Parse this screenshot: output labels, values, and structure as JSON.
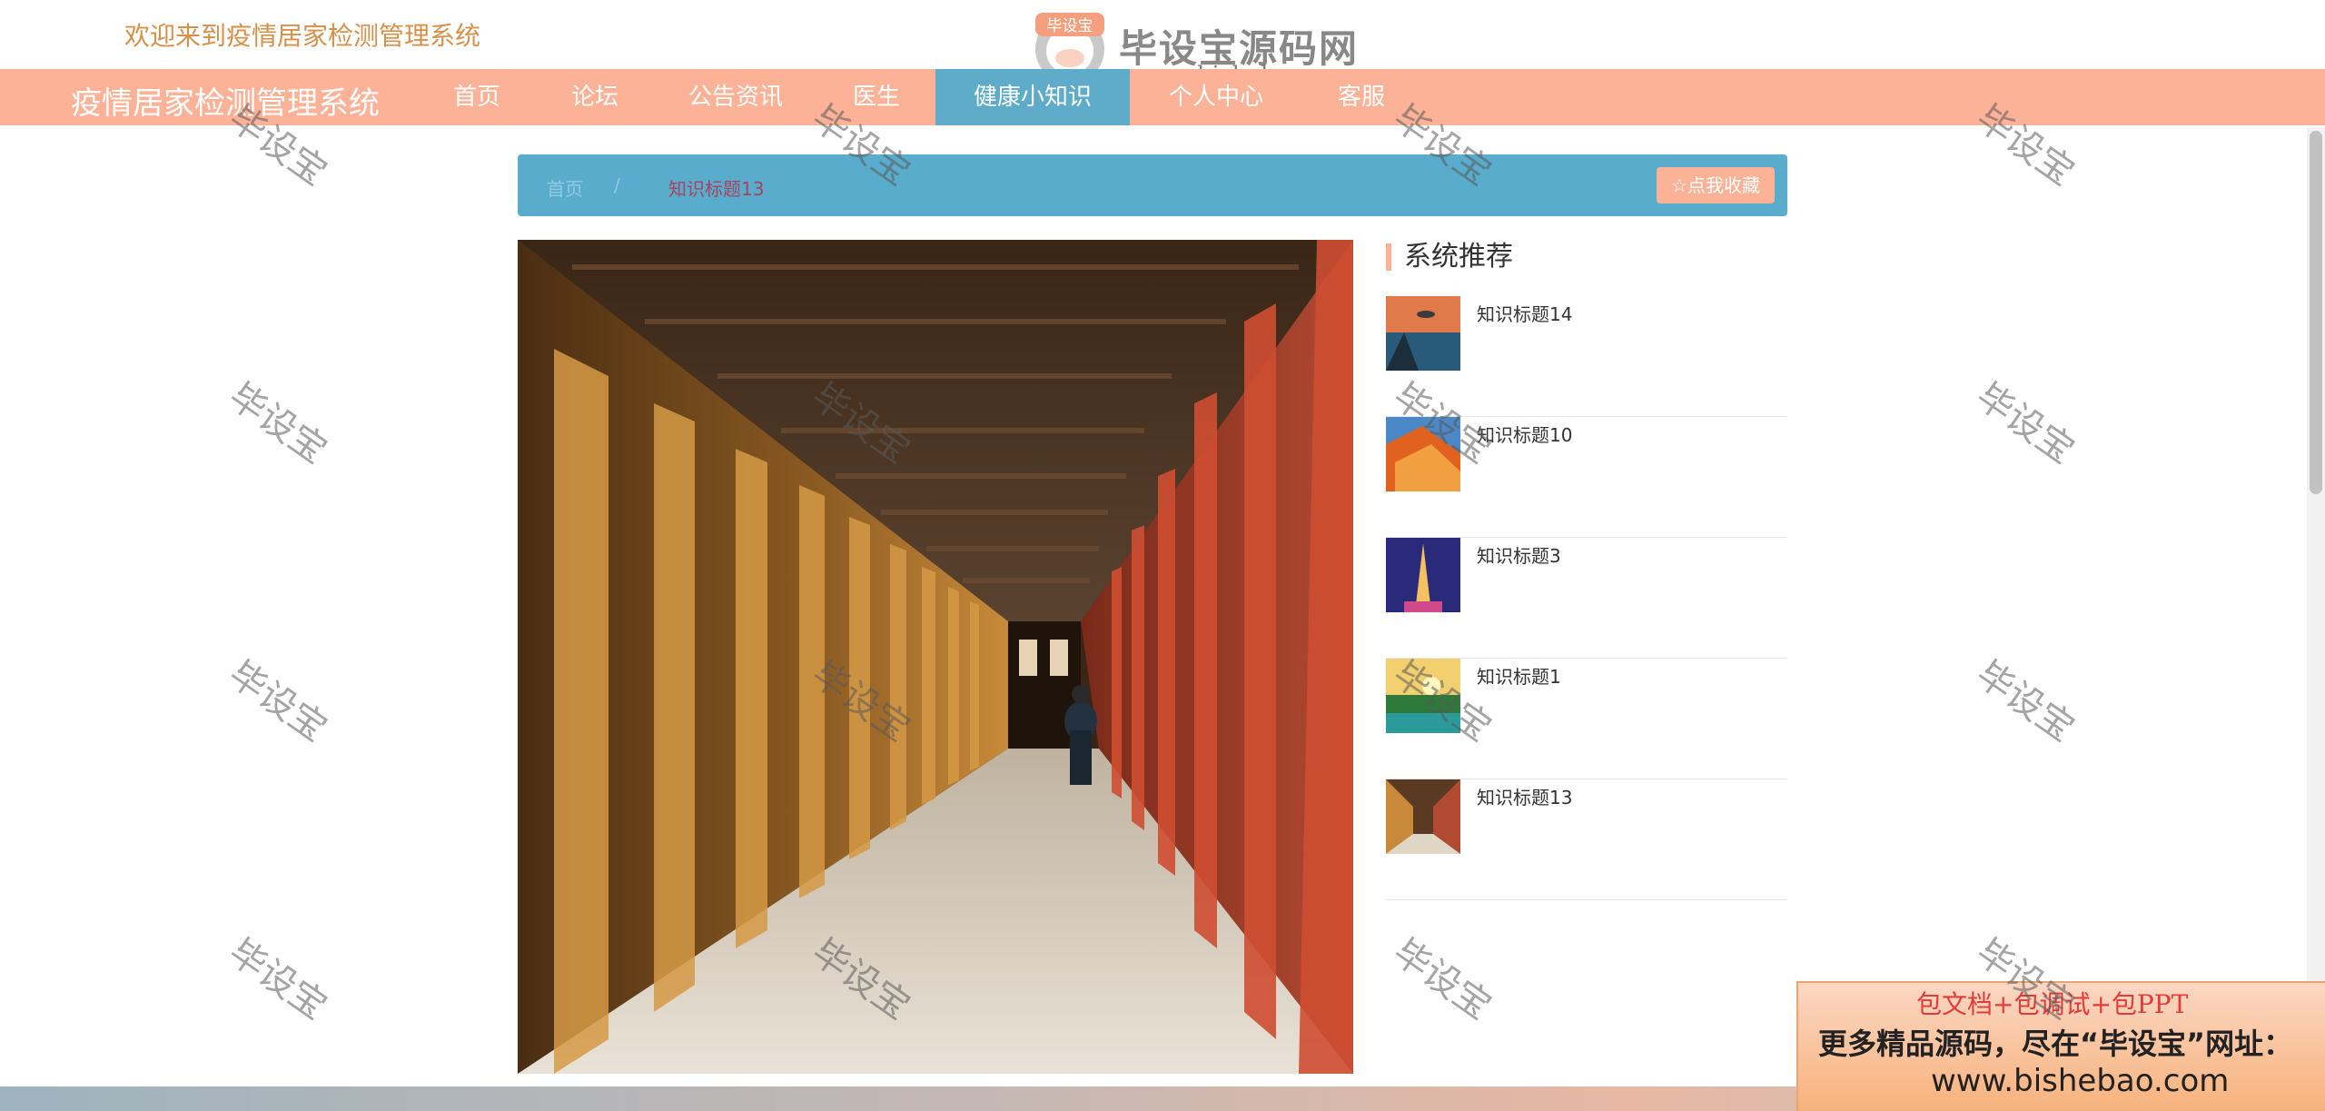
{
  "header": {
    "welcome": "欢迎来到疫情居家检测管理系统",
    "brand_name": "毕设宝源码网",
    "brand_badge": "毕设宝",
    "brand_url": "www.bishebao.com"
  },
  "navbar": {
    "system_title": "疫情居家检测管理系统",
    "items": [
      {
        "label": "首页",
        "active": false
      },
      {
        "label": "论坛",
        "active": false
      },
      {
        "label": "公告资讯",
        "active": false
      },
      {
        "label": "医生",
        "active": false
      },
      {
        "label": "健康小知识",
        "active": true
      },
      {
        "label": "个人中心",
        "active": false
      },
      {
        "label": "客服",
        "active": false
      }
    ],
    "colors": {
      "bar": "#fcb297",
      "active": "#5eacc9"
    }
  },
  "breadcrumb": {
    "home": "首页",
    "separator": "/",
    "current": "知识标题13",
    "favorite_button": "☆点我收藏"
  },
  "recommend": {
    "title": "系统推荐",
    "items": [
      {
        "label": "知识标题14"
      },
      {
        "label": "知识标题10"
      },
      {
        "label": "知识标题3"
      },
      {
        "label": "知识标题1"
      },
      {
        "label": "知识标题13"
      }
    ]
  },
  "ad": {
    "line1": "包文档+包调试+包PPT",
    "line2": "更多精品源码，尽在“毕设宝”网址：",
    "line3": "www.bishebao.com"
  },
  "watermark": "毕设宝"
}
